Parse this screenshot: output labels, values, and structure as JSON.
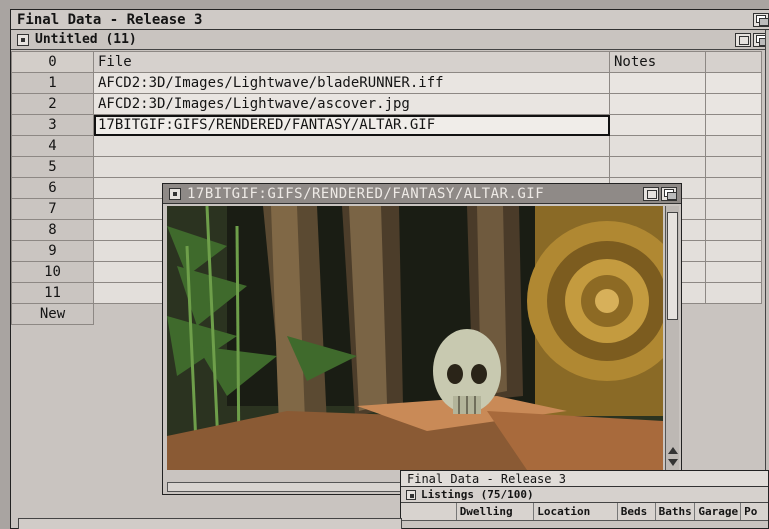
{
  "main_window": {
    "title": "Final Data - Release 3",
    "sheet_title": "Untitled (11)"
  },
  "spreadsheet": {
    "header_marker": "0",
    "columns": [
      "File",
      "Notes"
    ],
    "rows": [
      {
        "num": "1",
        "file": "AFCD2:3D/Images/Lightwave/bladeRUNNER.iff",
        "notes": ""
      },
      {
        "num": "2",
        "file": "AFCD2:3D/Images/Lightwave/ascover.jpg",
        "notes": ""
      },
      {
        "num": "3",
        "file": "17BITGIF:GIFS/RENDERED/FANTASY/ALTAR.GIF",
        "notes": ""
      },
      {
        "num": "4",
        "file": "",
        "notes": ""
      },
      {
        "num": "5",
        "file": "",
        "notes": ""
      },
      {
        "num": "6",
        "file": "",
        "notes": ""
      },
      {
        "num": "7",
        "file": "",
        "notes": ""
      },
      {
        "num": "8",
        "file": "",
        "notes": ""
      },
      {
        "num": "9",
        "file": "",
        "notes": ""
      },
      {
        "num": "10",
        "file": "",
        "notes": ""
      },
      {
        "num": "11",
        "file": "",
        "notes": ""
      }
    ],
    "new_row_label": "New",
    "selected_row": 3
  },
  "image_viewer": {
    "title": "17BITGIF:GIFS/RENDERED/FANTASY/ALTAR.GIF"
  },
  "listings_window": {
    "title": "Final Data - Release 3",
    "sheet_title": "Listings (75/100)",
    "columns": [
      "Dwelling",
      "Location",
      "Beds",
      "Baths",
      "Garage",
      "Po"
    ]
  },
  "colors": {
    "window_bg": "#c9c4c0",
    "cell_bg": "#e9e5e1",
    "viewer_title_bg": "#8f8a87"
  }
}
